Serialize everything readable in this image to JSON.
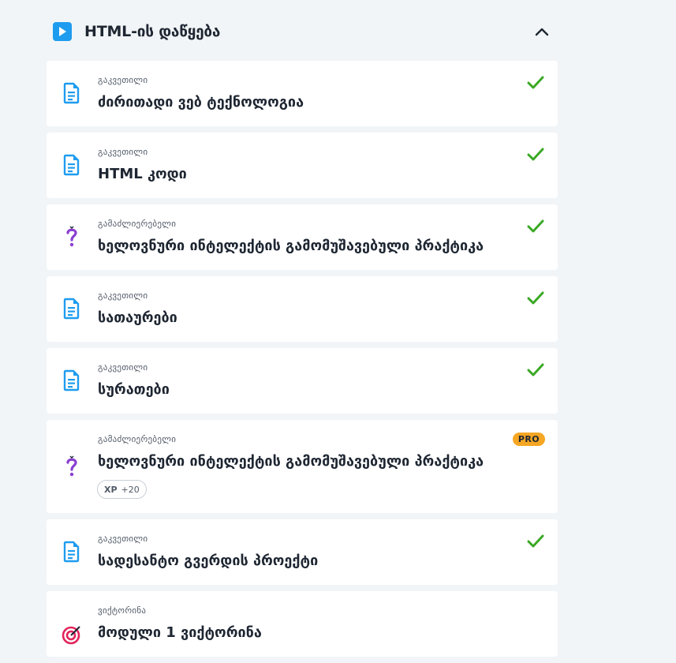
{
  "section": {
    "title": "HTML-ის დაწყება",
    "icon": "play-icon",
    "collapse_icon": "chevron-up-icon"
  },
  "items": [
    {
      "type": "გაკვეთილი",
      "title": "ძირითადი ვებ ტექნოლოგია",
      "icon": "document-icon",
      "status": "completed"
    },
    {
      "type": "გაკვეთილი",
      "title": "HTML კოდი",
      "icon": "document-icon",
      "status": "completed"
    },
    {
      "type": "გამაძლიერებელი",
      "title": "ხელოვნური ინტელექტის გამომუშავებული პრაქტიკა",
      "icon": "question-icon",
      "status": "completed"
    },
    {
      "type": "გაკვეთილი",
      "title": "სათაურები",
      "icon": "document-icon",
      "status": "completed"
    },
    {
      "type": "გაკვეთილი",
      "title": "სურათები",
      "icon": "document-icon",
      "status": "completed"
    },
    {
      "type": "გამაძლიერებელი",
      "title": "ხელოვნური ინტელექტის გამომუშავებული პრაქტიკა",
      "icon": "question-icon",
      "status": "pro",
      "badge": "PRO",
      "xp_label": "XP",
      "xp_value": "+20"
    },
    {
      "type": "გაკვეთილი",
      "title": "სადესანტო გვერდის პროექტი",
      "icon": "document-icon",
      "status": "completed"
    },
    {
      "type": "ვიქტორინა",
      "title": "მოდული 1 ვიქტორინა",
      "icon": "target-icon",
      "status": "none"
    }
  ],
  "colors": {
    "accent": "#1e9cef",
    "check": "#3aa925",
    "pro": "#f5a623",
    "booster": "#8a3fd1",
    "quiz": "#e2245b"
  }
}
